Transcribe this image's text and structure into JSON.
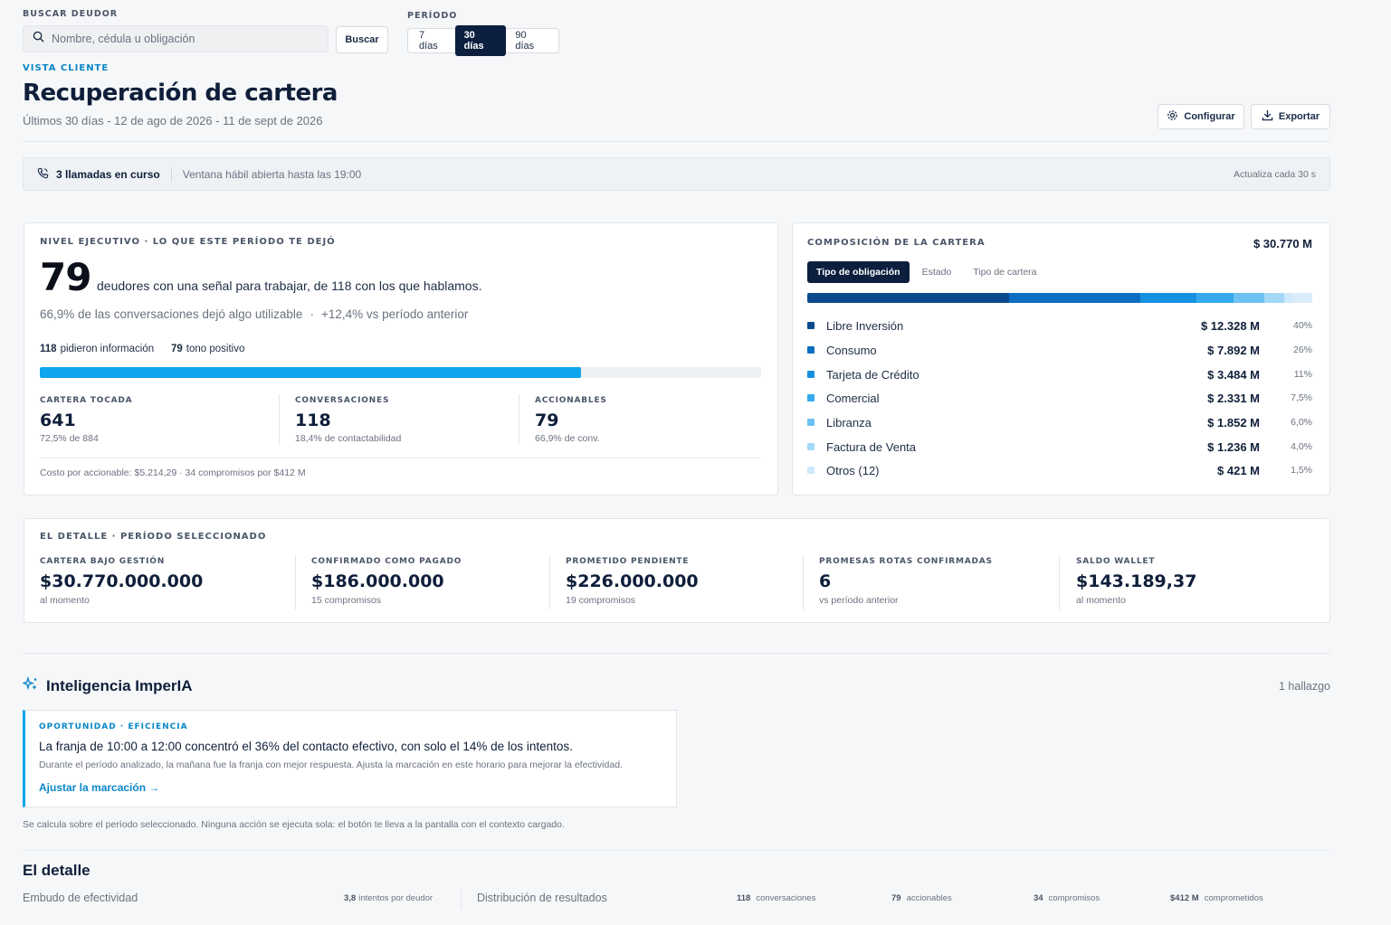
{
  "search": {
    "label": "BUSCAR DEUDOR",
    "placeholder": "Nombre, cédula u obligación",
    "button": "Buscar"
  },
  "period": {
    "label": "PERÍODO",
    "options": [
      "7 días",
      "30 días",
      "90 días"
    ],
    "selected": "30 días"
  },
  "header": {
    "eyebrow": "VISTA CLIENTE",
    "title": "Recuperación de cartera",
    "subtitle": "Últimos 30 días - 12 de ago de 2026 - 11 de sept de 2026",
    "configure": "Configurar",
    "export": "Exportar"
  },
  "banner": {
    "calls": "3 llamadas en curso",
    "window": "Ventana hábil abierta hasta las 19:00",
    "refresh": "Actualiza cada 30 s"
  },
  "executive": {
    "title": "NIVEL EJECUTIVO · LO QUE ESTE PERÍODO TE DEJÓ",
    "big_number": "79",
    "big_text": "deudores con una señal para trabajar, de 118 con los que hablamos.",
    "line2a": "66,9% de las conversaciones dejó algo utilizable",
    "line2sep": "·",
    "line2b": "+12,4% vs período anterior",
    "info_count": "118",
    "info_label": "pidieron información",
    "pos_count": "79",
    "pos_label": "tono positivo",
    "progress_ratio": 0.75,
    "kpis": [
      {
        "label": "CARTERA TOCADA",
        "value": "641",
        "sub": "72,5% de  884"
      },
      {
        "label": "CONVERSACIONES",
        "value": "118",
        "sub": "18,4% de contactabilidad"
      },
      {
        "label": "ACCIONABLES",
        "value": "79",
        "sub": "66,9% de conv."
      }
    ],
    "footer": "Costo por accionable: $5.214,29  ·  34 compromisos por $412 M"
  },
  "composition": {
    "title": "COMPOSICIÓN DE LA CARTERA",
    "total": "$ 30.770 M",
    "tabs": [
      "Tipo de obligación",
      "Estado",
      "Tipo de cartera"
    ],
    "active_tab": "Tipo de obligación",
    "rows": [
      {
        "name": "Libre Inversión",
        "amount": "$ 12.328 M",
        "pct": "40%",
        "share": 40,
        "color": "#0b4a8f"
      },
      {
        "name": "Consumo",
        "amount": "$ 7.892 M",
        "pct": "26%",
        "share": 26,
        "color": "#0a6fc2"
      },
      {
        "name": "Tarjeta de Crédito",
        "amount": "$ 3.484 M",
        "pct": "11%",
        "share": 11,
        "color": "#1591e0"
      },
      {
        "name": "Comercial",
        "amount": "$ 2.331 M",
        "pct": "7,5%",
        "share": 7.5,
        "color": "#36a9ec"
      },
      {
        "name": "Libranza",
        "amount": "$ 1.852 M",
        "pct": "6,0%",
        "share": 6,
        "color": "#6cc1f2"
      },
      {
        "name": "Factura de Venta",
        "amount": "$ 1.236 M",
        "pct": "4,0%",
        "share": 4,
        "color": "#a3d8f7"
      },
      {
        "name": "Otros (12)",
        "amount": "$ 421 M",
        "pct": "1,5%",
        "share": 1.5,
        "color": "#cde9fa"
      }
    ],
    "track_color": "#d9ecf8"
  },
  "detail": {
    "title": "EL DETALLE · PERÍODO SELECCIONADO",
    "items": [
      {
        "label": "CARTERA BAJO GESTIÓN",
        "value": "$30.770.000.000",
        "sub": "al momento"
      },
      {
        "label": "CONFIRMADO COMO PAGADO",
        "value": "$186.000.000",
        "sub": "15 compromisos"
      },
      {
        "label": "PROMETIDO PENDIENTE",
        "value": "$226.000.000",
        "sub": "19 compromisos"
      },
      {
        "label": "PROMESAS ROTAS CONFIRMADAS",
        "value": "6",
        "sub": "vs período anterior"
      },
      {
        "label": "SALDO WALLET",
        "value": "$143.189,37",
        "sub": "al momento"
      }
    ]
  },
  "intelligence": {
    "title": "Inteligencia ImperIA",
    "count": "1 hallazgo",
    "tag": "OPORTUNIDAD · EFICIENCIA",
    "headline": "La franja de 10:00 a 12:00 concentró el 36% del contacto efectivo, con solo el 14% de los intentos.",
    "body": "Durante el período analizado, la mañana fue la franja con mejor respuesta. Ajusta la marcación en este horario para mejorar la efectividad.",
    "action": "Ajustar la marcación →",
    "note": "Se calcula sobre el período seleccionado. Ninguna acción se ejecuta sola: el botón te lleva a la pantalla con el contexto cargado."
  },
  "bottom": {
    "title": "El detalle",
    "funnel": "Embudo de efectividad",
    "attempts_num": "3,8",
    "attempts_label": "intentos por deudor",
    "distribution": "Distribución de resultados",
    "stats": [
      {
        "num": "118",
        "label": "conversaciones"
      },
      {
        "num": "79",
        "label": "accionables"
      },
      {
        "num": "34",
        "label": "compromisos"
      },
      {
        "num": "$412 M",
        "label": "comprometidos"
      }
    ]
  }
}
